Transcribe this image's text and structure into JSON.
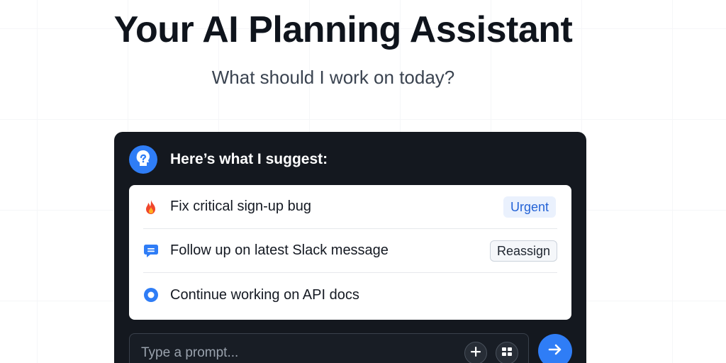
{
  "hero": {
    "title": "Your AI Planning Assistant",
    "subtitle": "What should I work on today?"
  },
  "assistant": {
    "avatar_icon": "assistant-head-icon",
    "heading": "Here’s what I suggest:"
  },
  "suggestions": [
    {
      "icon": "fire-icon",
      "label": "Fix critical sign-up bug",
      "badge": "Urgent"
    },
    {
      "icon": "chat-bubble-icon",
      "label": "Follow up on latest Slack message",
      "action": "Reassign"
    },
    {
      "icon": "target-dot-icon",
      "label": "Continue working on API docs"
    }
  ],
  "prompt": {
    "placeholder": "Type a prompt...",
    "value": "",
    "add_icon": "plus-icon",
    "grid_icon": "grid-icon",
    "send_icon": "arrow-right-icon"
  },
  "colors": {
    "accent": "#2f7df6",
    "panel_background": "#14181f",
    "badge_urgent_bg": "#eaf1fd",
    "badge_urgent_text": "#2463d6",
    "fire": "#f0462b"
  }
}
